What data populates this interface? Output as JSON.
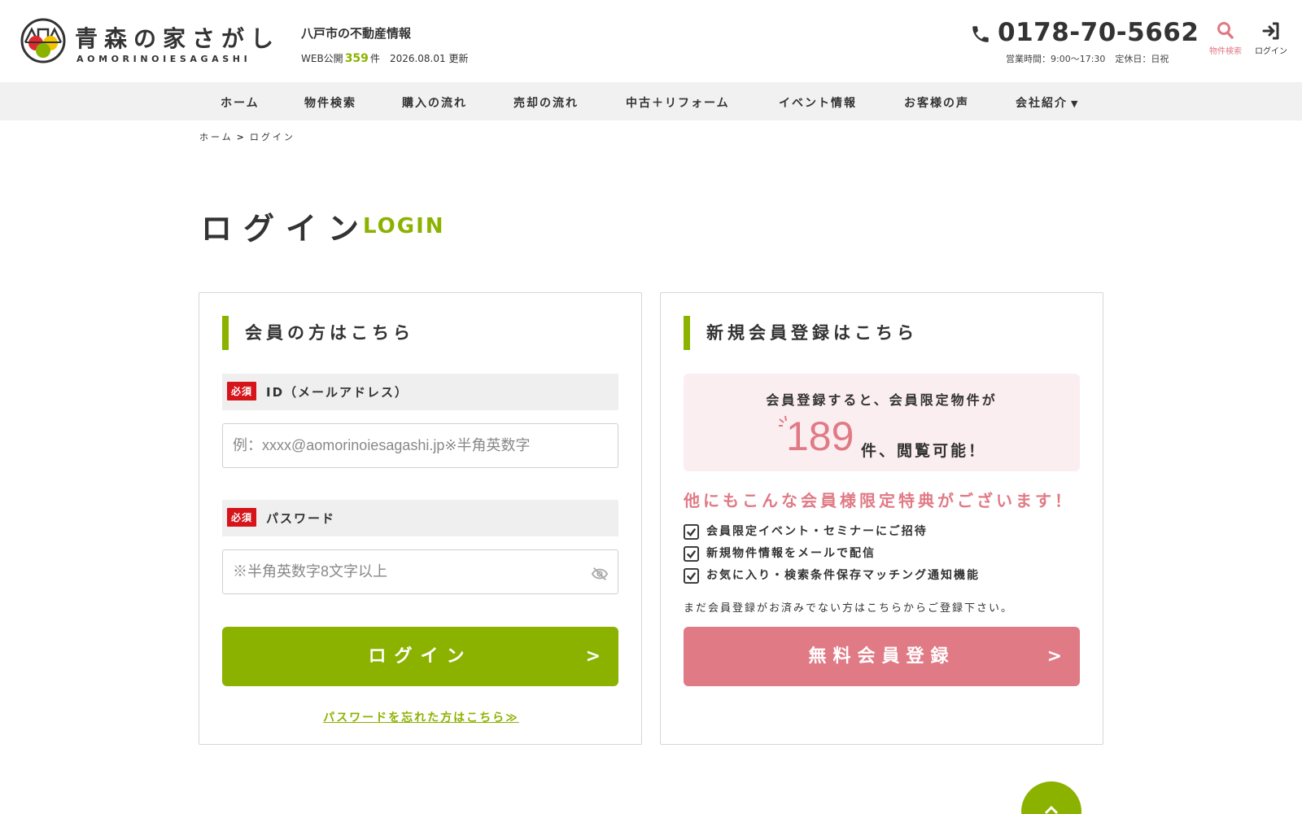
{
  "header": {
    "logo_jp": "青森の家さがし",
    "logo_en": "AOMORINOIESAGASHI",
    "tagline": "八戸市の不動産情報",
    "web_prefix": "WEB公開",
    "web_count": "359",
    "web_suffix": "件",
    "update_date": "2026.08.01 更新",
    "phone": "0178-70-5662",
    "hours": "営業時間：9:00〜17:30",
    "holiday": "定休日：日祝",
    "search_label": "物件検索",
    "login_label": "ログイン",
    "colors": {
      "accent_green": "#8cb200",
      "accent_pink": "#e07a85",
      "required_red": "#d6151b"
    }
  },
  "nav": {
    "items": [
      {
        "label": "ホーム"
      },
      {
        "label": "物件検索"
      },
      {
        "label": "購入の流れ"
      },
      {
        "label": "売却の流れ"
      },
      {
        "label": "中古＋リフォーム"
      },
      {
        "label": "イベント情報"
      },
      {
        "label": "お客様の声"
      },
      {
        "label": "会社紹介",
        "caret": "▼"
      }
    ]
  },
  "breadcrumb": {
    "home": "ホーム",
    "sep": ">",
    "current": "ログイン"
  },
  "page": {
    "title": "ログイン",
    "title_en": "LOGIN"
  },
  "member": {
    "heading": "会員の方はこちら",
    "required": "必須",
    "id_label": "ID（メールアドレス）",
    "id_placeholder": "例：xxxx@aomorinoiesagashi.jp※半角英数字",
    "id_value": "",
    "password_label": "パスワード",
    "password_placeholder": "※半角英数字8文字以上",
    "password_value": "",
    "login_button": "ログイン",
    "button_arrow": ">",
    "forgot_link": "パスワードを忘れた方はこちら≫"
  },
  "register": {
    "heading": "新規会員登録はこちら",
    "benefit_top": "会員登録すると、会員限定物件が",
    "benefit_count": "189",
    "benefit_after": "件、閲覧可能！",
    "perk_heading": "他にもこんな会員様限定特典がございます！",
    "perks": [
      "会員限定イベント・セミナーにご招待",
      "新規物件情報をメールで配信",
      "お気に入り・検索条件保存マッチング通知機能"
    ],
    "note": "まだ会員登録がお済みでない方はこちらからご登録下さい。",
    "register_button": "無料会員登録",
    "button_arrow": ">"
  }
}
